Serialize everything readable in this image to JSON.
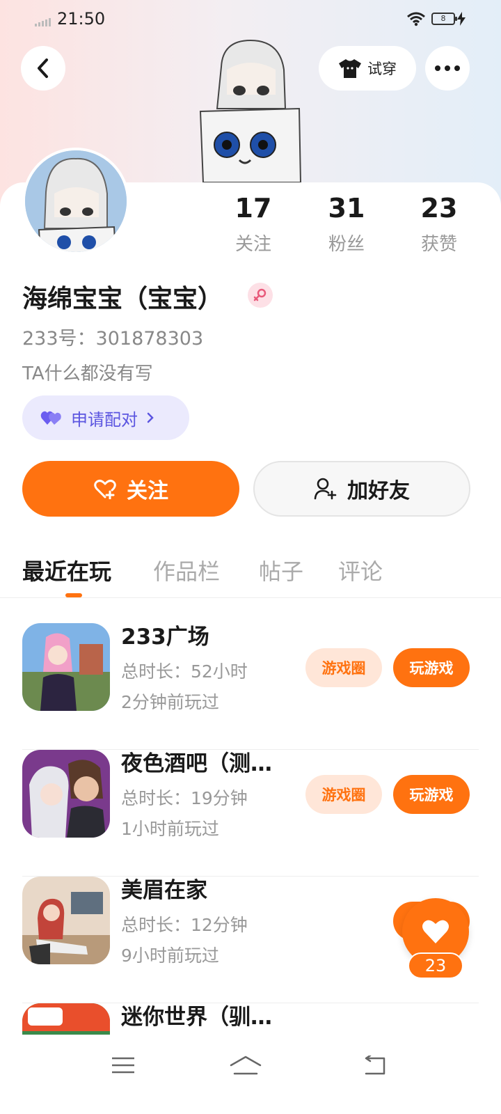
{
  "status_bar": {
    "time": "21:50",
    "battery": "8"
  },
  "header": {
    "tryon_label": "试穿"
  },
  "profile": {
    "stats": [
      {
        "value": "17",
        "label": "关注"
      },
      {
        "value": "31",
        "label": "粉丝"
      },
      {
        "value": "23",
        "label": "获赞"
      }
    ],
    "username": "海绵宝宝（宝宝）",
    "user_id": "233号：301878303",
    "bio": "TA什么都没有写",
    "pair_label": "申请配对"
  },
  "actions": {
    "follow_label": "关注",
    "add_friend_label": "加好友"
  },
  "tabs": [
    {
      "label": "最近在玩",
      "active": true
    },
    {
      "label": "作品栏",
      "active": false
    },
    {
      "label": "帖子",
      "active": false
    },
    {
      "label": "评论",
      "active": false
    }
  ],
  "games": [
    {
      "name": "233广场",
      "duration": "总时长：52小时",
      "last_played": "2分钟前玩过",
      "circle_label": "游戏圈",
      "play_label": "玩游戏"
    },
    {
      "name": "夜色酒吧（测…",
      "duration": "总时长：19分钟",
      "last_played": "1小时前玩过",
      "circle_label": "游戏圈",
      "play_label": "玩游戏"
    },
    {
      "name": "美眉在家",
      "duration": "总时长：12分钟",
      "last_played": "9小时前玩过",
      "circle_label": "",
      "play_label": ""
    },
    {
      "name": "迷你世界（驯…",
      "duration": "",
      "last_played": "",
      "circle_label": "",
      "play_label": ""
    }
  ],
  "floating_like": {
    "count": "23"
  },
  "colors": {
    "accent": "#ff7210",
    "pair_bg": "#ebeafd",
    "pair_text": "#5b55e0"
  },
  "icons": {
    "back": "chevron-left-icon",
    "tryon": "tshirt-icon",
    "more": "more-dots-icon",
    "gender": "female-icon",
    "pair": "double-heart-icon",
    "follow": "heart-plus-icon",
    "add_friend": "person-add-icon",
    "like": "heart-icon",
    "nav": [
      "menu-icon",
      "home-icon",
      "back-arrow-icon"
    ]
  }
}
